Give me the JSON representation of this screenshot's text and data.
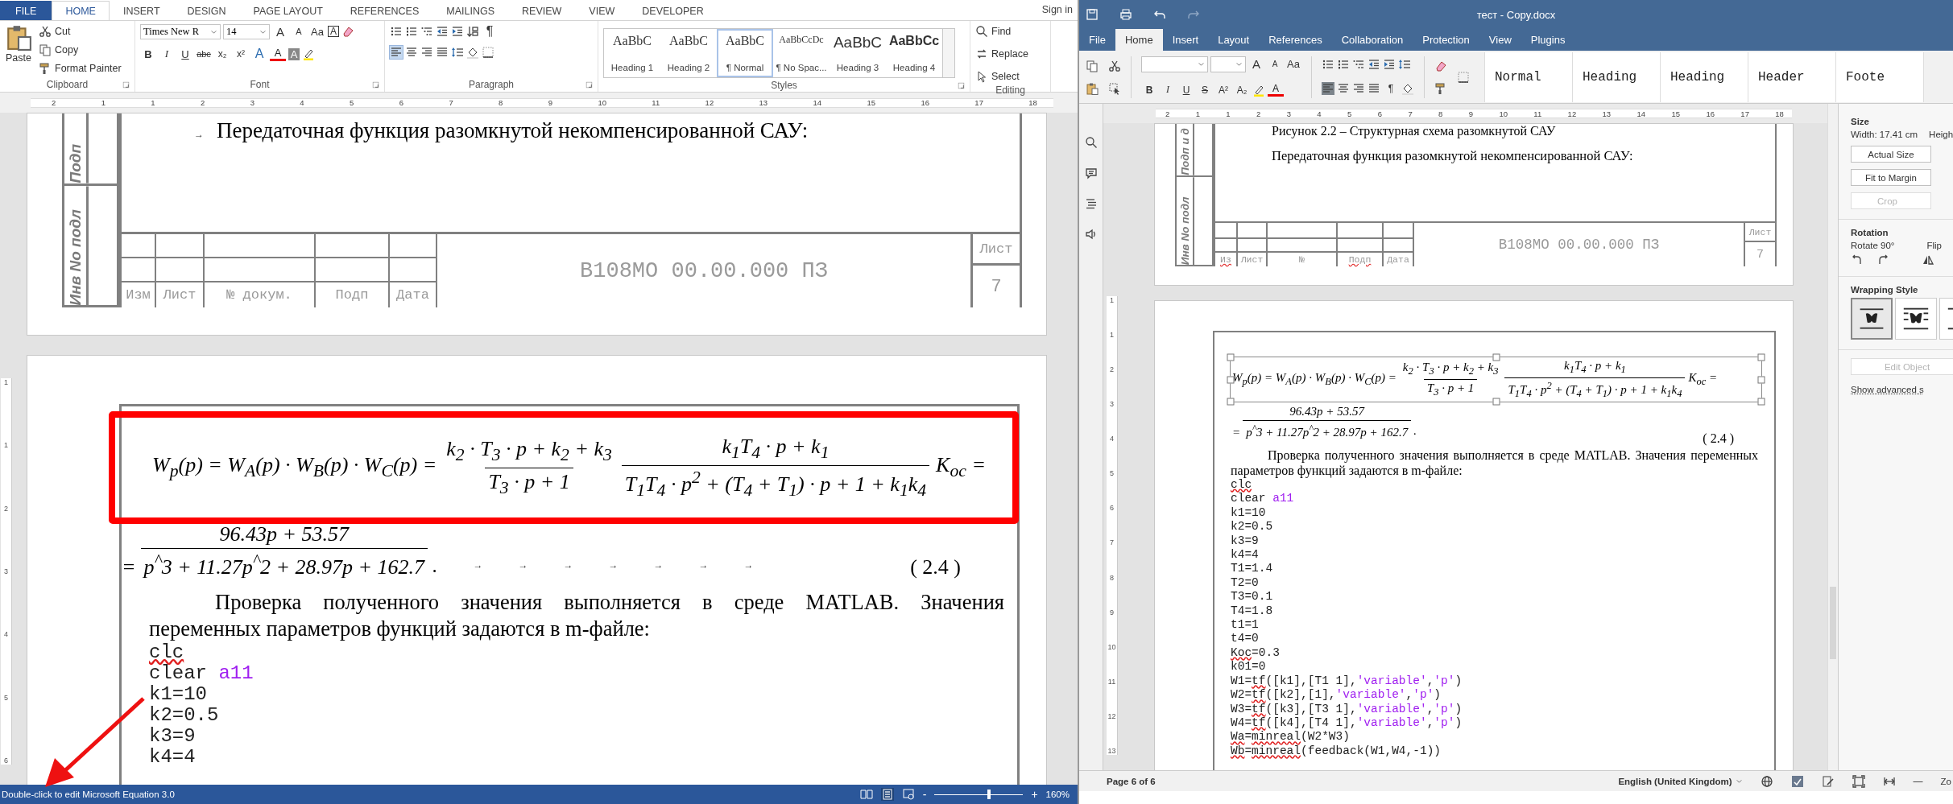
{
  "word": {
    "tabs": [
      {
        "label": "FILE",
        "kind": "file",
        "selected": false
      },
      {
        "label": "HOME",
        "kind": "tab",
        "selected": true
      },
      {
        "label": "INSERT",
        "kind": "tab",
        "selected": false
      },
      {
        "label": "DESIGN",
        "kind": "tab",
        "selected": false
      },
      {
        "label": "PAGE LAYOUT",
        "kind": "tab",
        "selected": false
      },
      {
        "label": "REFERENCES",
        "kind": "tab",
        "selected": false
      },
      {
        "label": "MAILINGS",
        "kind": "tab",
        "selected": false
      },
      {
        "label": "REVIEW",
        "kind": "tab",
        "selected": false
      },
      {
        "label": "VIEW",
        "kind": "tab",
        "selected": false
      },
      {
        "label": "DEVELOPER",
        "kind": "tab",
        "selected": false
      }
    ],
    "sign_in": "Sign in",
    "clipboard": {
      "paste": "Paste",
      "cut": "Cut",
      "copy": "Copy",
      "format_painter": "Format Painter",
      "label": "Clipboard"
    },
    "font": {
      "family": "Times New R",
      "size": "14",
      "label": "Font",
      "tools": [
        {
          "label": "A",
          "kind": "grow"
        },
        {
          "label": "A",
          "kind": "shrink"
        },
        {
          "label": "Aa",
          "kind": "case"
        },
        {
          "label": "A",
          "kind": "boxed"
        }
      ],
      "formats": [
        {
          "label": "B",
          "kind": "bold"
        },
        {
          "label": "I",
          "kind": "italic"
        },
        {
          "label": "U",
          "kind": "underline"
        },
        {
          "label": "abc",
          "kind": "strike"
        },
        {
          "label": "x₂",
          "kind": "sub"
        },
        {
          "label": "x²",
          "kind": "sup"
        },
        {
          "label": "A",
          "kind": "effects"
        },
        {
          "label": "A",
          "kind": "color"
        },
        {
          "label": "A",
          "kind": "shading"
        }
      ]
    },
    "paragraph": {
      "pilcrow": "¶",
      "label": "Paragraph",
      "alignment": [
        {
          "kind": "left",
          "selected": true
        },
        {
          "kind": "center",
          "selected": false
        },
        {
          "kind": "right",
          "selected": false
        },
        {
          "kind": "justify",
          "selected": false
        }
      ]
    },
    "styles": {
      "label": "Styles",
      "items": [
        {
          "preview": "AaBbC",
          "name": "Heading 1",
          "kind": "plain",
          "selected": false
        },
        {
          "preview": "AaBbC",
          "name": "Heading 2",
          "kind": "plain",
          "selected": false
        },
        {
          "preview": "AaBbC",
          "name": "¶ Normal",
          "kind": "plain",
          "selected": true
        },
        {
          "preview": "AaBbCcDc",
          "name": "¶ No Spac...",
          "kind": "small",
          "selected": false
        },
        {
          "preview": "AaBbC",
          "name": "Heading 3",
          "kind": "large",
          "selected": false
        },
        {
          "preview": "AaBbCc",
          "name": "Heading 4",
          "kind": "bold",
          "selected": false
        }
      ]
    },
    "editing": {
      "find": "Find",
      "replace": "Replace",
      "select": "Select",
      "label": "Editing"
    },
    "ruler": [
      "2",
      "1",
      "1",
      "2",
      "3",
      "4",
      "5",
      "6",
      "7",
      "8",
      "9",
      "10",
      "11",
      "12",
      "13",
      "14",
      "15",
      "16",
      "17",
      "18"
    ],
    "vruler": [
      "1",
      "1",
      "2",
      "3",
      "4",
      "5",
      "6"
    ],
    "doc": {
      "stamp_labels": [
        "Подп",
        "Инв No подл"
      ],
      "heading_mark": "→",
      "heading": "Передаточная функция разомкнутой некомпенсированной САУ:",
      "title_block": {
        "columns": [
          {
            "text": "Изм",
            "flagged": false
          },
          {
            "text": "Лист",
            "flagged": false
          },
          {
            "text": "№ докум.",
            "flagged": false
          },
          {
            "text": "Подп",
            "flagged": false
          },
          {
            "text": "Дата",
            "flagged": false
          }
        ],
        "designation": "B108MO 00.00.000 ПЗ",
        "sheet_label": "Лист",
        "sheet_number": "7"
      },
      "equation": {
        "lhs": "W$_{p}$(p) = W$_{A}$(p) · W$_{B}$(p) · W$_{C}$(p) =",
        "fractions": [
          {
            "num": "k$_{2}$ · T$_{3}$ · p + k$_{2}$ + k$_{3}$",
            "den": "T$_{3}$ · p + 1"
          },
          {
            "num": "k$_{1}$T$_{4}$ · p + k$_{1}$",
            "den": "T$_{1}$T$_{4}$ · p$^{2}$ + (T$_{4}$ + T$_{1}$) · p + 1 + k$_{1}$k$_{4}$"
          }
        ],
        "tail": "K$_{oc}$ ="
      },
      "equation2": {
        "lead": "=",
        "num": "96.43p + 53.57",
        "den": "p$^{^}$3 + 11.27p$^{^}$2 + 28.97p + 162.7",
        "end": ".",
        "tab_marks": [
          "→",
          "→",
          "→",
          "→",
          "→",
          "→",
          "→"
        ]
      },
      "equation_number": "( 2.4 )",
      "paragraph": "Проверка полученного значения выполняется в среде MATLAB. Значения переменных параметров функций задаются в m-файле:",
      "code": [
        [
          {
            "text": "clc",
            "kind": "flagged"
          }
        ],
        [
          {
            "text": "clear ",
            "kind": "plain"
          },
          {
            "text": "a11",
            "kind": "string"
          }
        ],
        [
          {
            "text": "k1=10",
            "kind": "plain"
          }
        ],
        [
          {
            "text": "k2=0.5",
            "kind": "plain"
          }
        ],
        [
          {
            "text": "k3=9",
            "kind": "plain"
          }
        ],
        [
          {
            "text": "k4=4",
            "kind": "plain"
          }
        ]
      ]
    },
    "status": {
      "message": "Double-click to edit Microsoft Equation 3.0",
      "zoom_out": "-",
      "zoom_in": "+",
      "zoom": "160%",
      "zoom_slider": {
        "level": 0.6
      }
    }
  },
  "office": {
    "title": "тест - Copy.docx",
    "tabs": [
      {
        "label": "File",
        "selected": false
      },
      {
        "label": "Home",
        "selected": true
      },
      {
        "label": "Insert",
        "selected": false
      },
      {
        "label": "Layout",
        "selected": false
      },
      {
        "label": "References",
        "selected": false
      },
      {
        "label": "Collaboration",
        "selected": false
      },
      {
        "label": "Protection",
        "selected": false
      },
      {
        "label": "View",
        "selected": false
      },
      {
        "label": "Plugins",
        "selected": false
      }
    ],
    "font_tools": [
      {
        "label": "A",
        "kind": "grow"
      },
      {
        "label": "A",
        "kind": "shrink"
      },
      {
        "label": "Aa",
        "kind": "case"
      }
    ],
    "formats": [
      {
        "label": "B",
        "kind": "bold"
      },
      {
        "label": "I",
        "kind": "italic"
      },
      {
        "label": "U",
        "kind": "underline"
      },
      {
        "label": "S",
        "kind": "strike"
      },
      {
        "label": "A²",
        "kind": "sup"
      },
      {
        "label": "A₂",
        "kind": "sub"
      }
    ],
    "font_color": "A",
    "pilcrow": "¶",
    "alignment": [
      {
        "kind": "left",
        "selected": true
      },
      {
        "kind": "center",
        "selected": false
      },
      {
        "kind": "right",
        "selected": false
      },
      {
        "kind": "justify",
        "selected": false
      }
    ],
    "styles": [
      "Normal",
      "Heading",
      "Heading",
      "Header",
      "Foote"
    ],
    "ruler": [
      "2",
      "1",
      "1",
      "2",
      "3",
      "4",
      "5",
      "6",
      "7",
      "8",
      "9",
      "10",
      "11",
      "12",
      "13",
      "14",
      "15",
      "16",
      "17",
      "18"
    ],
    "vruler": [
      "1",
      "1",
      "2",
      "3",
      "4",
      "5",
      "6",
      "7",
      "8",
      "9",
      "10",
      "11",
      "12",
      "13"
    ],
    "doc": {
      "stamp_labels": [
        "Подп и д",
        "Инв No подл"
      ],
      "caption": "Рисунок 2.2 – Структурная схема разомкнутой САУ",
      "heading": "Передаточная функция разомкнутой некомпенсированной САУ:",
      "title_block": {
        "columns": [
          {
            "text": "Из",
            "flagged": true
          },
          {
            "text": "Лист",
            "flagged": false
          },
          {
            "text": "№",
            "flagged": false
          },
          {
            "text": "Подп",
            "flagged": true
          },
          {
            "text": "Дата",
            "flagged": false
          }
        ],
        "designation": "B108MO 00.00.000 ПЗ",
        "sheet_label": "Лист",
        "sheet_number": "7"
      },
      "equation": {
        "lhs": "W$_{p}$(p) = W$_{A}$(p) · W$_{B}$(p) · W$_{C}$(p) =",
        "fractions": [
          {
            "num": "k$_{2}$ · T$_{3}$ · p + k$_{2}$ + k$_{3}$",
            "den": "T$_{3}$ · p + 1"
          },
          {
            "num": "k$_{1}$T$_{4}$ · p + k$_{1}$",
            "den": "T$_{1}$T$_{4}$ · p$^{2}$ + (T$_{4}$ + T$_{1}$) · p + 1 + k$_{1}$k$_{4}$"
          }
        ],
        "tail": "K$_{oc}$ ="
      },
      "equation2": {
        "lead": "=",
        "num": "96.43p + 53.57",
        "den": "p$^{^}$3 + 11.27p$^{^}$2 + 28.97p + 162.7",
        "end": "."
      },
      "equation_number": "( 2.4 )",
      "paragraph": "Проверка полученного значения выполняется в среде MATLAB. Значения переменных параметров функций задаются в m-файле:",
      "code": [
        [
          {
            "text": "clc",
            "kind": "flagged"
          }
        ],
        [
          {
            "text": "clear ",
            "kind": "plain"
          },
          {
            "text": "a11",
            "kind": "string"
          }
        ],
        [
          {
            "text": "k1=10",
            "kind": "plain"
          }
        ],
        [
          {
            "text": "k2=0.5",
            "kind": "plain"
          }
        ],
        [
          {
            "text": "k3=9",
            "kind": "plain"
          }
        ],
        [
          {
            "text": "k4=4",
            "kind": "plain"
          }
        ],
        [
          {
            "text": "T1=1.4",
            "kind": "plain"
          }
        ],
        [
          {
            "text": "T2=0",
            "kind": "plain"
          }
        ],
        [
          {
            "text": "T3=0.1",
            "kind": "plain"
          }
        ],
        [
          {
            "text": "T4=1.8",
            "kind": "plain"
          }
        ],
        [
          {
            "text": "t1=1",
            "kind": "plain"
          }
        ],
        [
          {
            "text": "t4=0",
            "kind": "plain"
          }
        ],
        [
          {
            "text": "Koc",
            "kind": "flagged"
          },
          {
            "text": "=0.3",
            "kind": "plain"
          }
        ],
        [
          {
            "text": "k01=0",
            "kind": "plain"
          }
        ],
        [
          {
            "text": "W1=",
            "kind": "plain"
          },
          {
            "text": "tf",
            "kind": "flagged"
          },
          {
            "text": "([k1],[T1 1],",
            "kind": "plain"
          },
          {
            "text": "'variable'",
            "kind": "string"
          },
          {
            "text": ",",
            "kind": "plain"
          },
          {
            "text": "'p'",
            "kind": "string"
          },
          {
            "text": ")",
            "kind": "plain"
          }
        ],
        [
          {
            "text": "W2=",
            "kind": "plain"
          },
          {
            "text": "tf",
            "kind": "flagged"
          },
          {
            "text": "([k2],[1],",
            "kind": "plain"
          },
          {
            "text": "'variable'",
            "kind": "string"
          },
          {
            "text": ",",
            "kind": "plain"
          },
          {
            "text": "'p'",
            "kind": "string"
          },
          {
            "text": ")",
            "kind": "plain"
          }
        ],
        [
          {
            "text": "W3=",
            "kind": "plain"
          },
          {
            "text": "tf",
            "kind": "flagged"
          },
          {
            "text": "([k3],[T3 1],",
            "kind": "plain"
          },
          {
            "text": "'variable'",
            "kind": "string"
          },
          {
            "text": ",",
            "kind": "plain"
          },
          {
            "text": "'p'",
            "kind": "string"
          },
          {
            "text": ")",
            "kind": "plain"
          }
        ],
        [
          {
            "text": "W4=",
            "kind": "plain"
          },
          {
            "text": "tf",
            "kind": "flagged"
          },
          {
            "text": "([k4],[T4 1],",
            "kind": "plain"
          },
          {
            "text": "'variable'",
            "kind": "string"
          },
          {
            "text": ",",
            "kind": "plain"
          },
          {
            "text": "'p'",
            "kind": "string"
          },
          {
            "text": ")",
            "kind": "plain"
          }
        ],
        [
          {
            "text": "Wa",
            "kind": "flagged"
          },
          {
            "text": "=",
            "kind": "plain"
          },
          {
            "text": "minreal",
            "kind": "flagged"
          },
          {
            "text": "(W2*W3)",
            "kind": "plain"
          }
        ],
        [
          {
            "text": "Wb",
            "kind": "flagged"
          },
          {
            "text": "=",
            "kind": "plain"
          },
          {
            "text": "minreal",
            "kind": "flagged"
          },
          {
            "text": "(feedback(W1,W4,-1))",
            "kind": "plain"
          }
        ]
      ]
    },
    "panel": {
      "size_title": "Size",
      "width": "Width: 17.41 cm",
      "height": "Heigh",
      "actual_size": "Actual Size",
      "fit_to_margin": "Fit to Margin",
      "crop": {
        "label": "Crop",
        "disabled": true
      },
      "rotation_title": "Rotation",
      "rotate": "Rotate 90°",
      "flip": "Flip",
      "wrapping_title": "Wrapping Style",
      "wrap_options": [
        {
          "kind": "inline",
          "selected": true
        },
        {
          "kind": "square",
          "selected": false
        },
        {
          "kind": "tight",
          "selected": false
        }
      ],
      "edit_object": {
        "label": "Edit Object",
        "disabled": true
      },
      "advanced": "Show advanced s"
    },
    "status": {
      "page": "Page 6 of 6",
      "language": "English (United Kingdom)",
      "zoom_out": "—",
      "zoom": "Zo"
    }
  }
}
